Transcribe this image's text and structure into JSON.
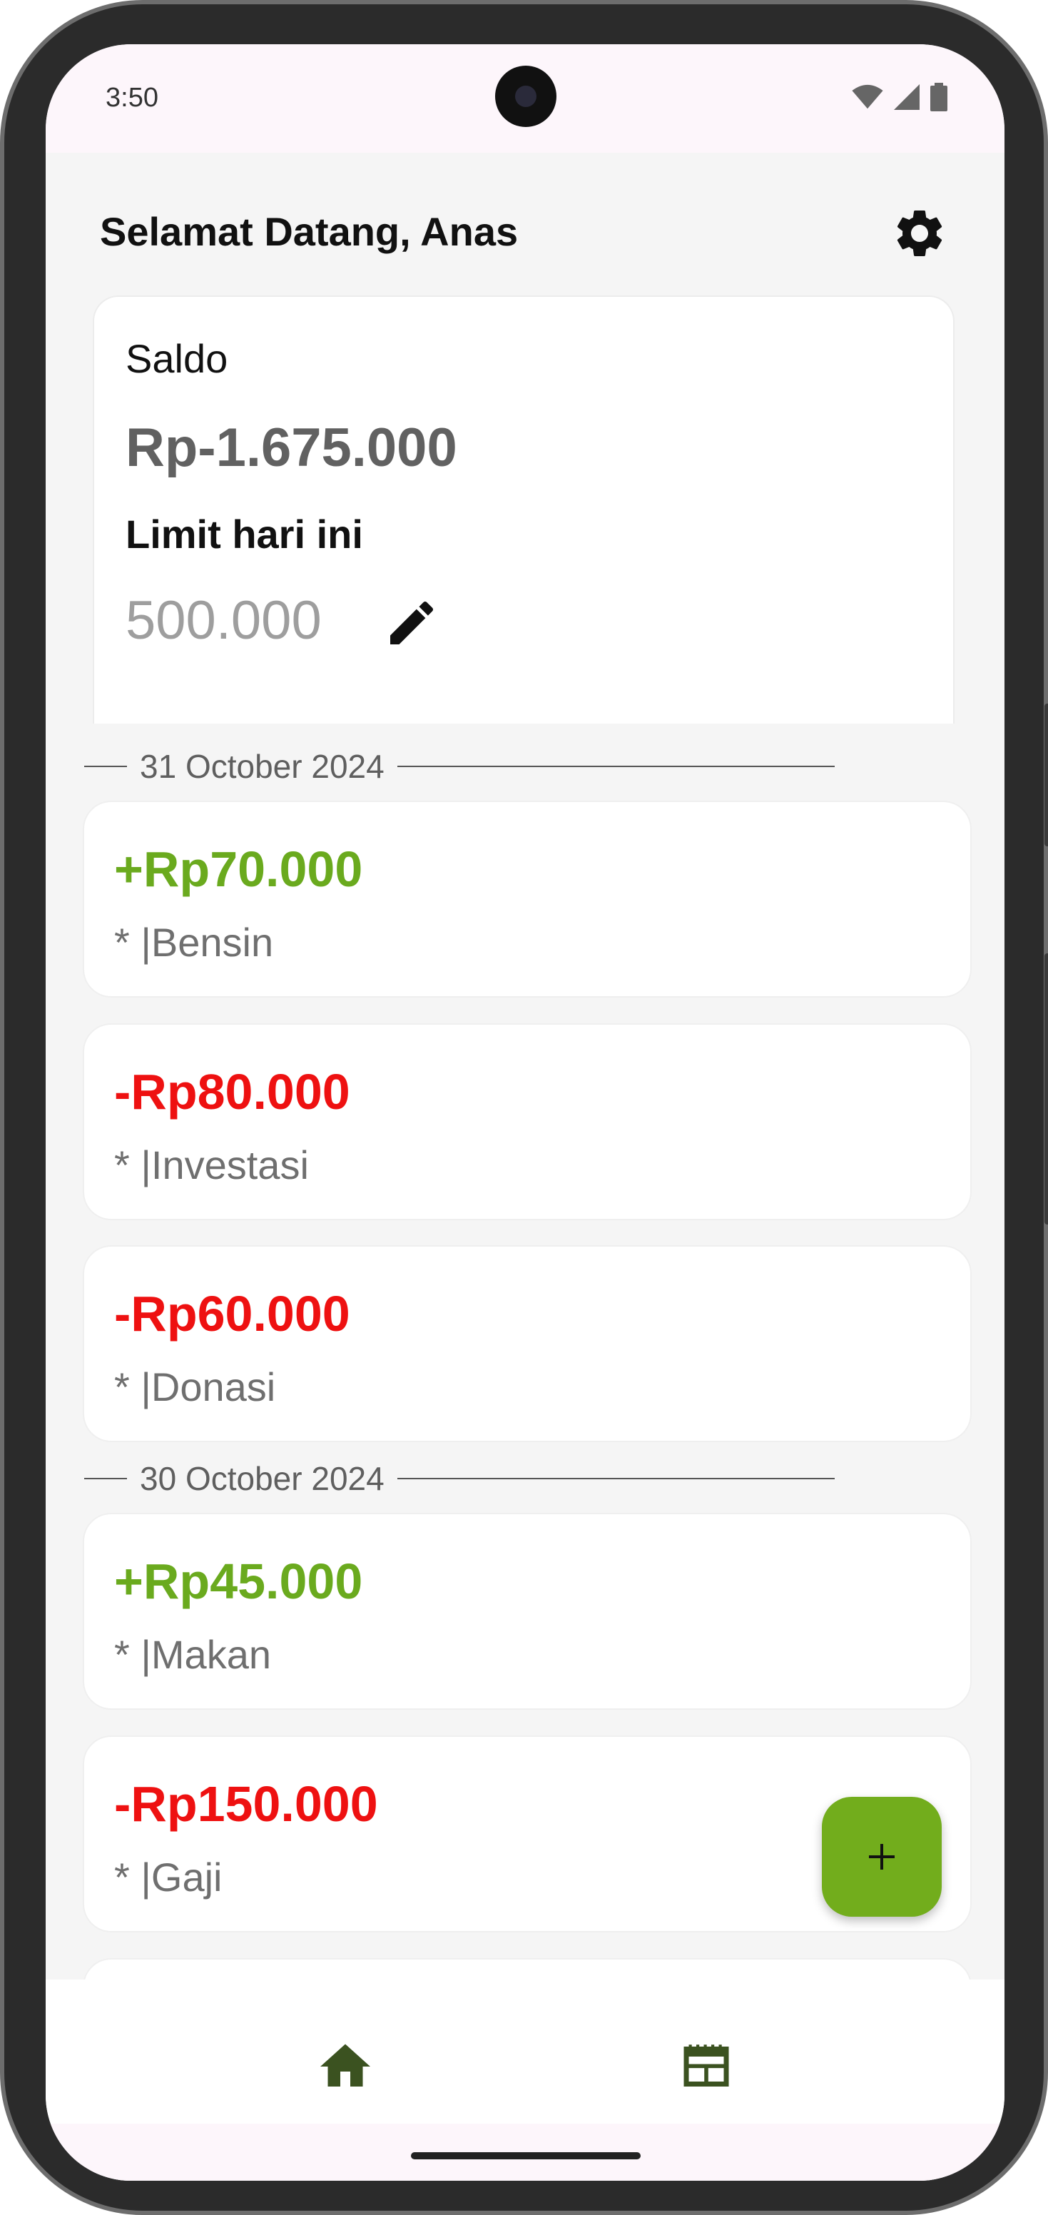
{
  "status_bar": {
    "time": "3:50"
  },
  "header": {
    "greeting": "Selamat Datang, Anas"
  },
  "balance": {
    "saldo_label": "Saldo",
    "saldo_value": "Rp-1.675.000",
    "limit_label": "Limit hari ini",
    "limit_value": "500.000"
  },
  "groups": [
    {
      "date": "31 October 2024",
      "transactions": [
        {
          "amount": "+Rp70.000",
          "type": "income",
          "note": "* |Bensin"
        },
        {
          "amount": "-Rp80.000",
          "type": "expense",
          "note": "* |Investasi"
        },
        {
          "amount": "-Rp60.000",
          "type": "expense",
          "note": "* |Donasi"
        }
      ]
    },
    {
      "date": "30 October 2024",
      "transactions": [
        {
          "amount": "+Rp45.000",
          "type": "income",
          "note": "* |Makan"
        },
        {
          "amount": "-Rp150.000",
          "type": "expense",
          "note": "* |Gaji"
        }
      ]
    }
  ],
  "colors": {
    "income": "#6aaa1e",
    "expense": "#ee1111",
    "accent": "#72ad1c",
    "nav_icon": "#3b5220"
  },
  "icons": {
    "settings": "gear-icon",
    "edit": "pencil-icon",
    "add": "plus-icon",
    "nav_home": "home-icon",
    "nav_report": "report-icon"
  }
}
